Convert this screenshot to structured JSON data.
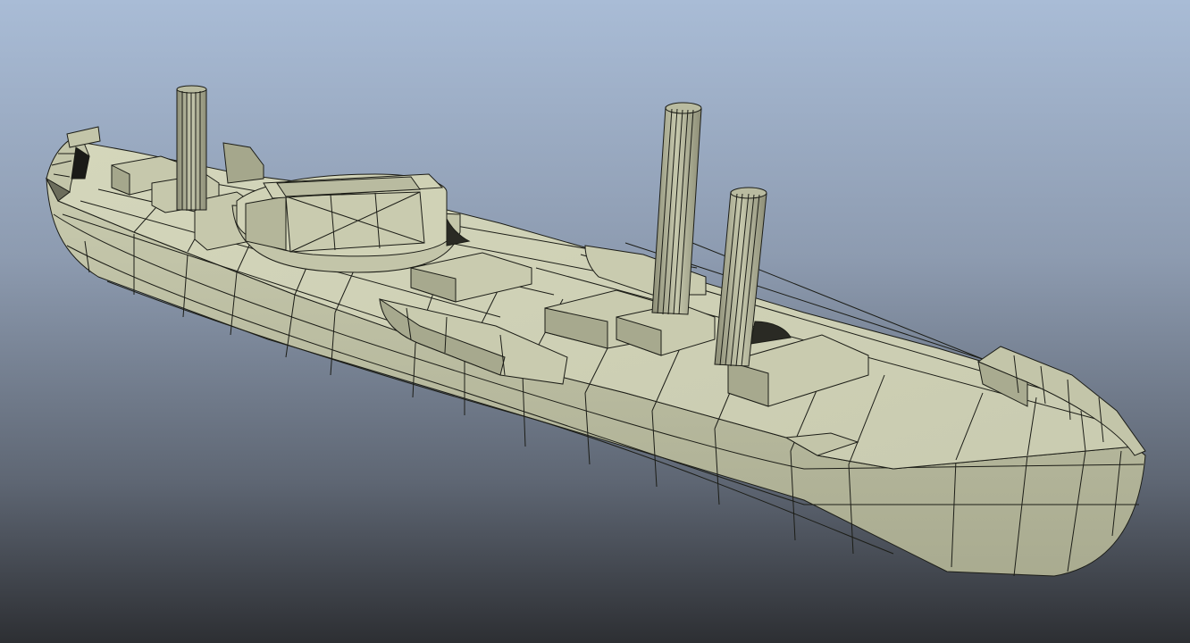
{
  "viewport": {
    "background_top": "#a9bcd6",
    "background_bottom": "#2d2f33",
    "mesh_fill": "#cfd1b4",
    "mesh_shadow": "#9a9b82",
    "wire_color": "#1c1d17"
  },
  "model": {
    "icon": "ship-mesh-icon",
    "display_mode": "wireframe-on-shaded"
  }
}
